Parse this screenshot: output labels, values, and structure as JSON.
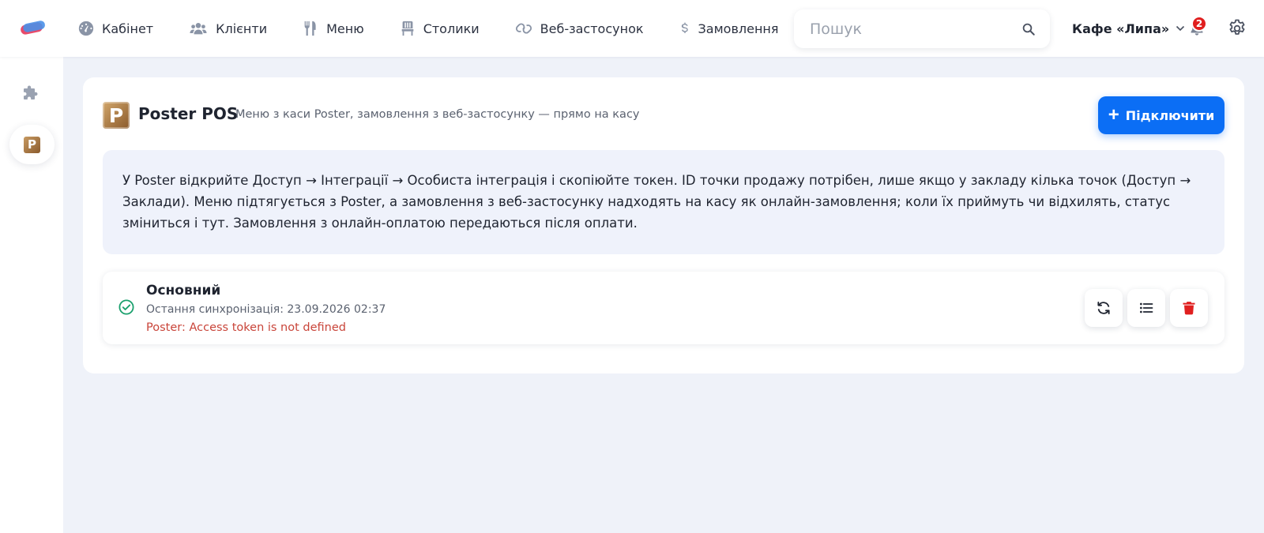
{
  "nav": {
    "items": [
      {
        "label": "Кабінет",
        "icon": "gauge-icon"
      },
      {
        "label": "Клієнти",
        "icon": "users-icon"
      },
      {
        "label": "Меню",
        "icon": "utensils-icon"
      },
      {
        "label": "Столики",
        "icon": "chair-icon"
      },
      {
        "label": "Веб-застосунок",
        "icon": "link-icon"
      },
      {
        "label": "Замовлення",
        "icon": "dollar-icon"
      }
    ]
  },
  "search": {
    "placeholder": "Пошук",
    "value": ""
  },
  "venue": {
    "name": "Кафе «Липа»"
  },
  "notifications": {
    "count": "2"
  },
  "integration": {
    "logo_letter": "P",
    "title": "Poster POS",
    "subtitle": "Меню з каси Poster, замовлення з веб-застосунку — прямо на касу",
    "connect_label": "Підключити",
    "connect_plus": "+",
    "info": "У Poster відкрийте Доступ → Інтеграції → Особиста інтеграція і скопіюйте токен. ID точки продажу потрібен, лише якщо у закладу кілька точок (Доступ → Заклади). Меню підтягується з Poster, а замовлення з веб-застосунку надходять на касу як онлайн-замовлення; коли їх приймуть чи відхилять, статус зміниться і тут. Замовлення з онлайн-оплатою передаються після оплати.",
    "item": {
      "name": "Основний",
      "sync_text": "Остання синхронізація: 23.09.2026 02:37",
      "error": "Poster: Access token is not defined"
    }
  },
  "colors": {
    "accent": "#0b6ef5",
    "error": "#c9453a",
    "success": "#1aa06d",
    "danger": "#e01f1f"
  }
}
